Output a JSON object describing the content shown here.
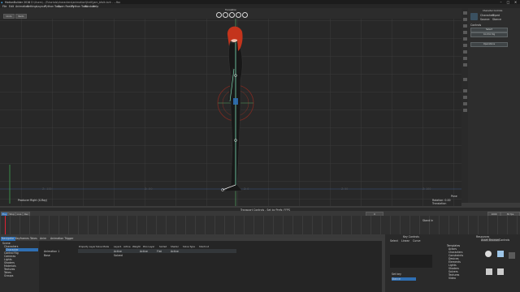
{
  "window": {
    "title": "MotionBuilder 2016",
    "path": "- D:\\Users\\...\\Tutorials\\characters\\animation\\lhelt\\jam_bfolk.bvh - ...fbx",
    "controls": [
      "–",
      "□",
      "✕"
    ]
  },
  "menu": [
    "File",
    "Edit",
    "Animation",
    "Settings",
    "Layout",
    "Python Tools",
    "Open Reality",
    "Python Tools",
    "Window",
    "Help"
  ],
  "toolbar": {
    "undo": "Undo",
    "redo": "Redo",
    "gizmo_label": "Translation"
  },
  "viewport": {
    "camera_label": "Producer Right (X-Ray)",
    "pane_info": "Pane",
    "pane_info2": "Rotation: 0.00 Translation",
    "axis_labels": [
      "Z: -100",
      "Z: -50",
      "Z: 0",
      "Z: 50",
      "Z: 100"
    ]
  },
  "right_panel": {
    "title": "Character Controls",
    "character_label": "Character:",
    "character_value": "Biped",
    "source_label": "Source:",
    "source_value": "Stance",
    "edit_section": "Controls",
    "buttons": [
      "Select",
      "Control Rig",
      "Operations"
    ]
  },
  "status": {
    "center": "Transport Controls - Set by Prefs: FFPS"
  },
  "transport": {
    "play_labels": [
      "Play",
      "Stop",
      "Live",
      "Rec"
    ],
    "start": "0",
    "end": "1000",
    "fps": "30 fps",
    "mode": "Stand In"
  },
  "bottom_tabs": [
    "Navigator",
    "Keyframes",
    "Takes",
    "Anim",
    "Animation Trigger"
  ],
  "navigator": {
    "tree": [
      "Scene",
      "Characters",
      "Character",
      "Control Rig",
      "Cameras",
      "Lights",
      "Shaders",
      "Materials",
      "Textures",
      "Takes",
      "Groups"
    ],
    "columns": [
      "Property Layer",
      "Solve Mode",
      "Layer1",
      "Active",
      "Weight",
      "Pins Layer",
      "Sorted",
      "Shader",
      "Solve Type",
      "Shortcut"
    ],
    "cells": [
      "Animation 1",
      "Base",
      "Active",
      "Solved",
      "Active",
      "Flat",
      "Active"
    ]
  },
  "curves": {
    "title": "Key Controls",
    "items": [
      "Select",
      "Linear",
      "Curve"
    ],
    "label1": "Set key",
    "label2": "Stance"
  },
  "asset_browser": {
    "title": "Resources",
    "tabs": [
      "Asset Browser",
      "Controls"
    ],
    "items": [
      "Templates",
      "Actors",
      "Characters",
      "Constraints",
      "Devices",
      "Elements",
      "Lights",
      "Shaders",
      "Solvers",
      "Textures",
      "Video"
    ]
  },
  "colors": {
    "accent": "#2f6fb3",
    "bone": "#7fe3b8",
    "hair": "#c4341c",
    "skin": "#f0c0b0"
  }
}
